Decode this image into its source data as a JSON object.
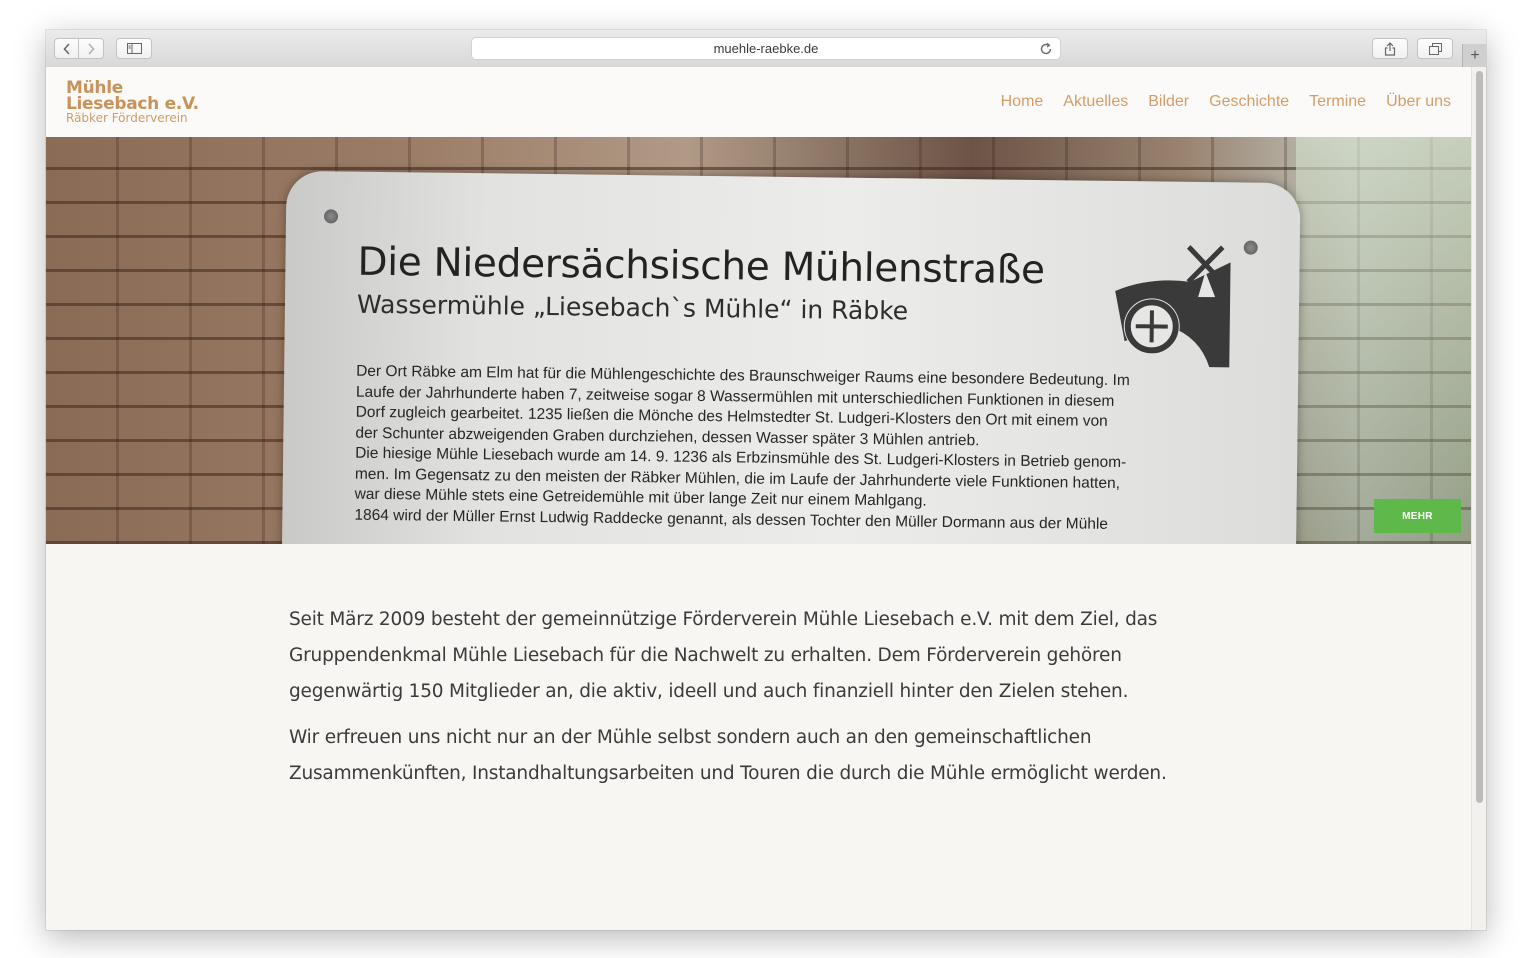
{
  "browser": {
    "url": "muehle-raebke.de",
    "new_tab_label": "+"
  },
  "site": {
    "logo": {
      "line1": "Mühle",
      "line2": "Liesebach e.V.",
      "line3": "Räbker Förderverein"
    },
    "nav": [
      "Home",
      "Aktuelles",
      "Bilder",
      "Geschichte",
      "Termine",
      "Über uns"
    ],
    "hero": {
      "sign_title": "Die Niedersächsische Mühlenstraße",
      "sign_subtitle": "Wassermühle „Liesebach`s Mühle“ in Räbke",
      "sign_lines": [
        "Der Ort Räbke am Elm hat für die Mühlengeschichte des Braunschweiger Raums eine besondere Bedeutung. Im",
        "Laufe der Jahrhunderte haben 7, zeitweise sogar 8 Wassermühlen mit unterschiedlichen Funktionen in diesem",
        "Dorf zugleich gearbeitet. 1235 ließen die Mönche des Helmstedter St. Ludgeri-Klosters den Ort mit einem von",
        "der Schunter abzweigenden Graben durchziehen, dessen Wasser später 3 Mühlen antrieb.",
        "Die hiesige Mühle Liesebach wurde am 14. 9. 1236 als Erbzinsmühle des St. Ludgeri-Klosters in Betrieb genom-",
        "men. Im Gegensatz zu den meisten der Räbker Mühlen, die im Laufe der Jahrhunderte viele Funktionen hatten,",
        "war diese Mühle stets eine Getreidemühle mit über lange Zeit nur einem Mahlgang.",
        "1864 wird der Müller Ernst Ludwig Raddecke genannt, als dessen Tochter den Müller Dormann aus der Mühle"
      ],
      "button_label": "MEHR"
    },
    "paragraphs": [
      "Seit März 2009 besteht der gemeinnützige Förderverein Mühle Liesebach e.V. mit dem Ziel, das Gruppendenkmal Mühle Liesebach für die Nachwelt zu erhalten. Dem Förderverein gehören gegenwärtig 150 Mitglieder an, die aktiv, ideell und auch finanziell hinter den Zielen stehen.",
      "Wir erfreuen uns nicht nur an der Mühle selbst sondern auch an den gemeinschaftlichen Zusammenkünften, Instandhaltungsarbeiten und Touren die durch die Mühle ermöglicht werden."
    ]
  },
  "colors": {
    "accent": "#d49d66",
    "button": "#5fb84a",
    "background": "#f8f6f3"
  }
}
